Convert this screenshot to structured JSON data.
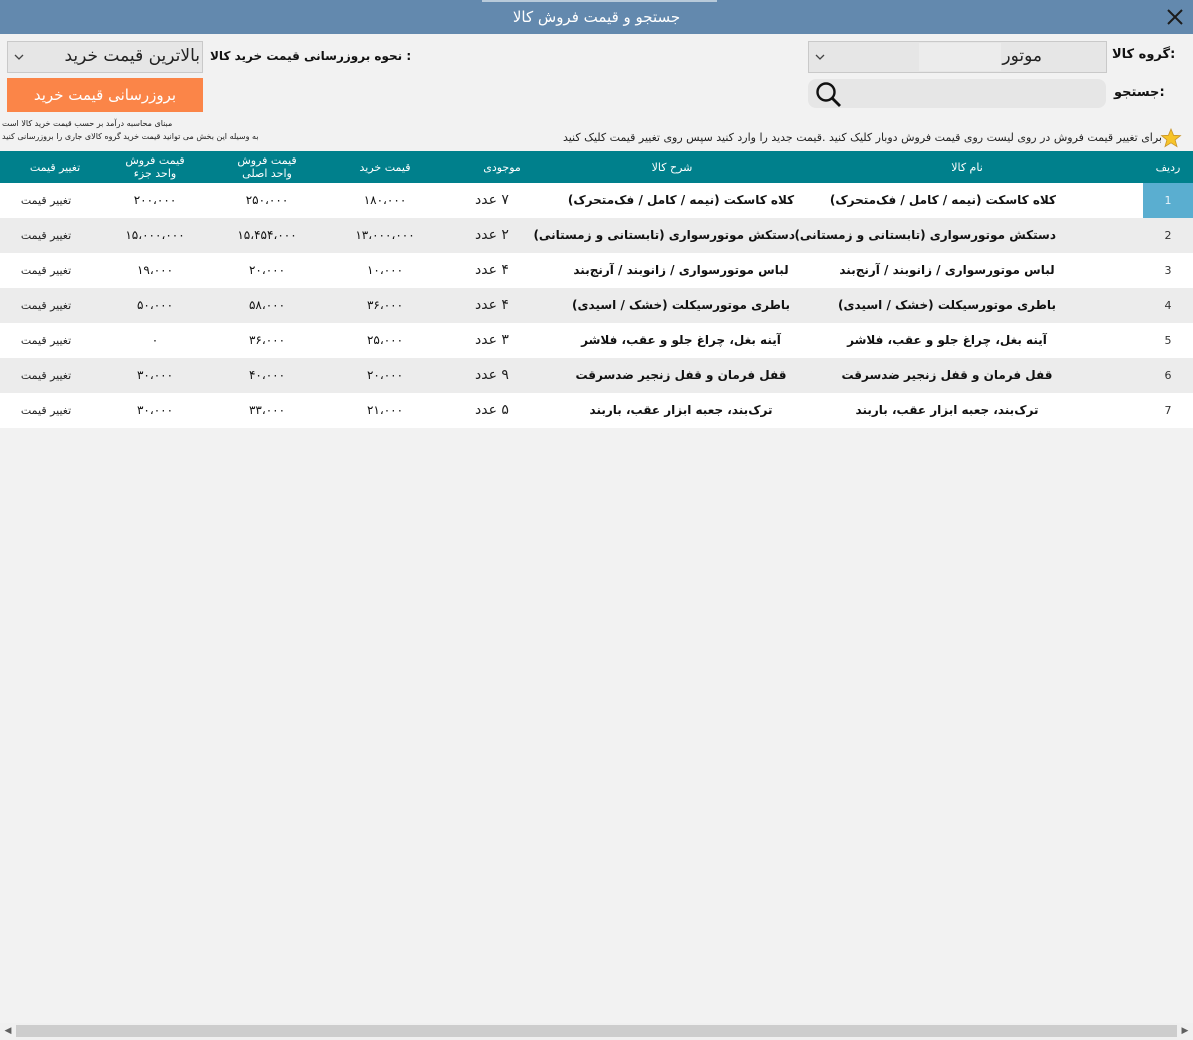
{
  "window": {
    "title": "جستجو و قیمت فروش کالا"
  },
  "filters": {
    "group_label": "گروه کالا:",
    "group_value": "موتور",
    "search_label": "جستجو:",
    "search_value": "",
    "update_mode_label": "نحوه بروزرسانی قیمت خرید کالا :",
    "update_mode_value": "بالاترین قیمت خرید",
    "update_button": "بروزرسانی قیمت خرید",
    "note_line1": "مبنای محاسبه درآمد بر حسب قیمت خرید کالا است",
    "note_line2": "به وسیله این بخش می توانید قیمت خرید گروه کالای جاری را بروزرسانی کنید",
    "hint": "برای تغییر قیمت فروش در روی لیست روی قیمت فروش دوبار کلیک کنید .قیمت جدید را وارد کنید سپس روی تغییر قیمت کلیک کنید"
  },
  "table": {
    "headers": {
      "index": "ردیف",
      "name": "نام کالا",
      "desc": "شرح کالا",
      "stock": "موجودی",
      "buy": "قیمت خرید",
      "sell_main_1": "قیمت فروش",
      "sell_main_2": "واحد اصلی",
      "sell_part_1": "قیمت فروش",
      "sell_part_2": "واحد جزء",
      "change": "تغییر قیمت"
    },
    "rows": [
      {
        "index": "1",
        "name": "کلاه کاسکت (نیمه / کامل / فک‌متحرک)",
        "desc": "کلاه کاسکت (نیمه / کامل / فک‌متحرک)",
        "stock": "۷ عدد",
        "buy": "۱۸۰،۰۰۰",
        "sell": "۲۵۰،۰۰۰",
        "part": "۲۰۰،۰۰۰",
        "change": "تغییر قیمت"
      },
      {
        "index": "2",
        "name": "دستکش موتورسواری (تابستانی و زمستانی)",
        "desc": "دستکش موتورسواری (تابستانی و زمستانی)",
        "stock": "۲ عدد",
        "buy": "۱۳،۰۰۰،۰۰۰",
        "sell": "۱۵،۴۵۴،۰۰۰",
        "part": "۱۵،۰۰۰،۰۰۰",
        "change": "تغییر قیمت"
      },
      {
        "index": "3",
        "name": "لباس موتورسواری / زانوبند / آرنج‌بند",
        "desc": "لباس موتورسواری / زانوبند / آرنج‌بند",
        "stock": "۴ عدد",
        "buy": "۱۰،۰۰۰",
        "sell": "۲۰،۰۰۰",
        "part": "۱۹،۰۰۰",
        "change": "تغییر قیمت"
      },
      {
        "index": "4",
        "name": "باطری موتورسیکلت (خشک / اسیدی)",
        "desc": "باطری موتورسیکلت (خشک / اسیدی)",
        "stock": "۴ عدد",
        "buy": "۳۶،۰۰۰",
        "sell": "۵۸،۰۰۰",
        "part": "۵۰،۰۰۰",
        "change": "تغییر قیمت"
      },
      {
        "index": "5",
        "name": "آینه بغل، چراغ جلو و عقب، فلاشر",
        "desc": "آینه بغل، چراغ جلو و عقب، فلاشر",
        "stock": "۳ عدد",
        "buy": "۲۵،۰۰۰",
        "sell": "۳۶،۰۰۰",
        "part": "۰",
        "change": "تغییر قیمت"
      },
      {
        "index": "6",
        "name": "قفل فرمان و قفل زنجیر ضدسرقت",
        "desc": "قفل فرمان و قفل زنجیر ضدسرقت",
        "stock": "۹ عدد",
        "buy": "۲۰،۰۰۰",
        "sell": "۴۰،۰۰۰",
        "part": "۳۰،۰۰۰",
        "change": "تغییر قیمت"
      },
      {
        "index": "7",
        "name": "ترک‌بند، جعبه ابزار عقب، باربند",
        "desc": "ترک‌بند، جعبه ابزار عقب، باربند",
        "stock": "۵ عدد",
        "buy": "۲۱،۰۰۰",
        "sell": "۳۳،۰۰۰",
        "part": "۳۰،۰۰۰",
        "change": "تغییر قیمت"
      }
    ]
  },
  "colors": {
    "titlebar": "#6389ae",
    "table_header": "#00808c",
    "update_button": "#fb8548",
    "selected_row_index": "#5aaed0"
  },
  "icons": {
    "close": "close-icon",
    "search": "search-icon",
    "hint": "star-icon",
    "dropdown": "chevron-down-icon"
  }
}
